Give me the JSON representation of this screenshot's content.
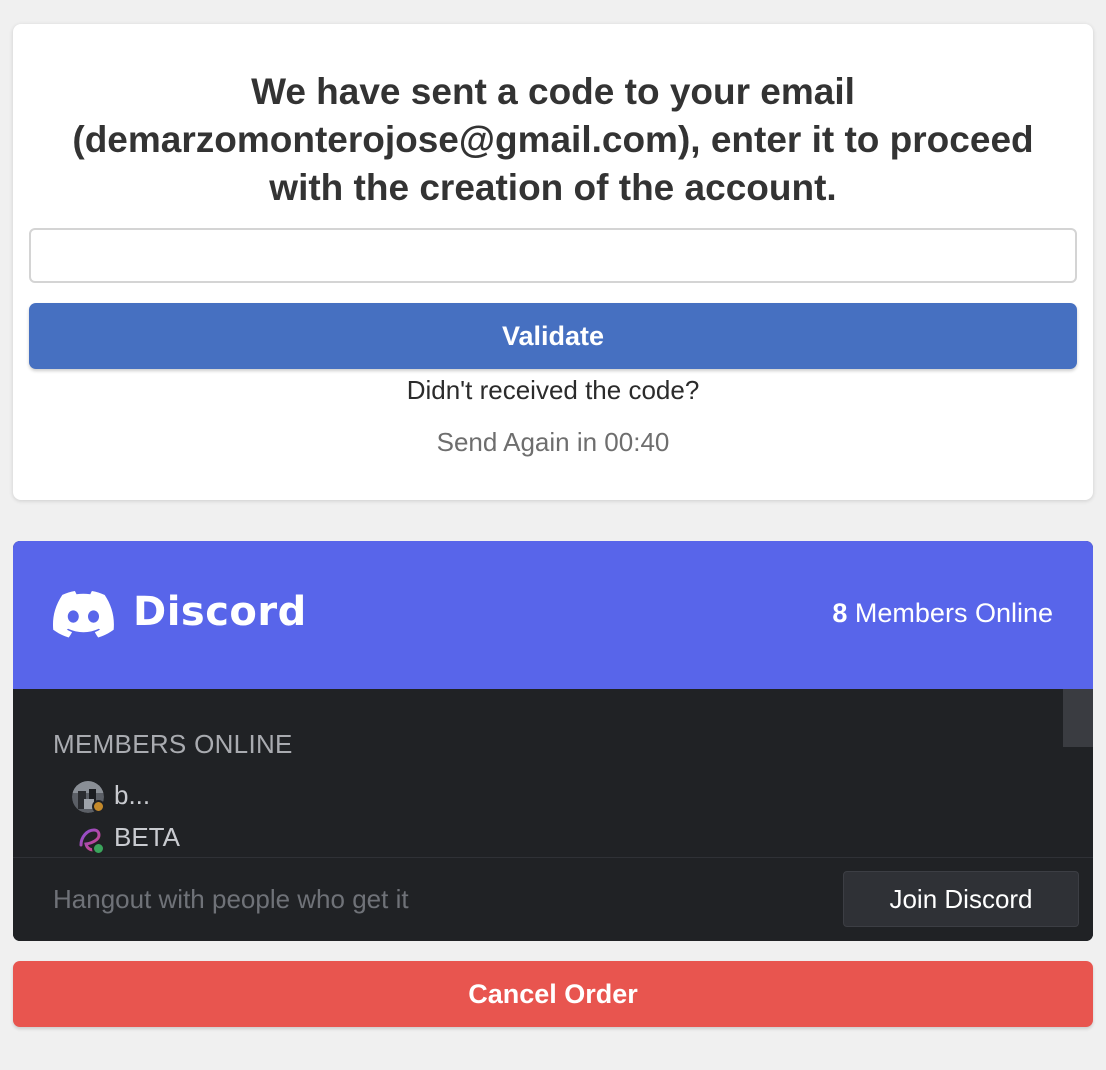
{
  "verification": {
    "message": "We have sent a code to your email (demarzomonterojose@gmail.com), enter it to proceed with the creation of the account.",
    "code_value": "",
    "code_placeholder": "",
    "validate_label": "Validate",
    "not_received_label": "Didn't received the code?",
    "resend_label": "Send Again in 00:40"
  },
  "discord": {
    "wordmark": "Discord",
    "online_count": "8",
    "online_label": "Members Online",
    "members_heading": "MEMBERS ONLINE",
    "members": [
      {
        "name": "b...",
        "avatar_icon": "user-photo-avatar",
        "status_color": "#c58a2b"
      },
      {
        "name": "BETA",
        "avatar_icon": "beta-e-logo-avatar",
        "status_color": "#3ba55c"
      }
    ],
    "tagline": "Hangout with people who get it",
    "join_label": "Join Discord",
    "brand_color": "#5865ea"
  },
  "actions": {
    "cancel_label": "Cancel Order",
    "cancel_color": "#e8554f",
    "validate_color": "#4670c1"
  }
}
